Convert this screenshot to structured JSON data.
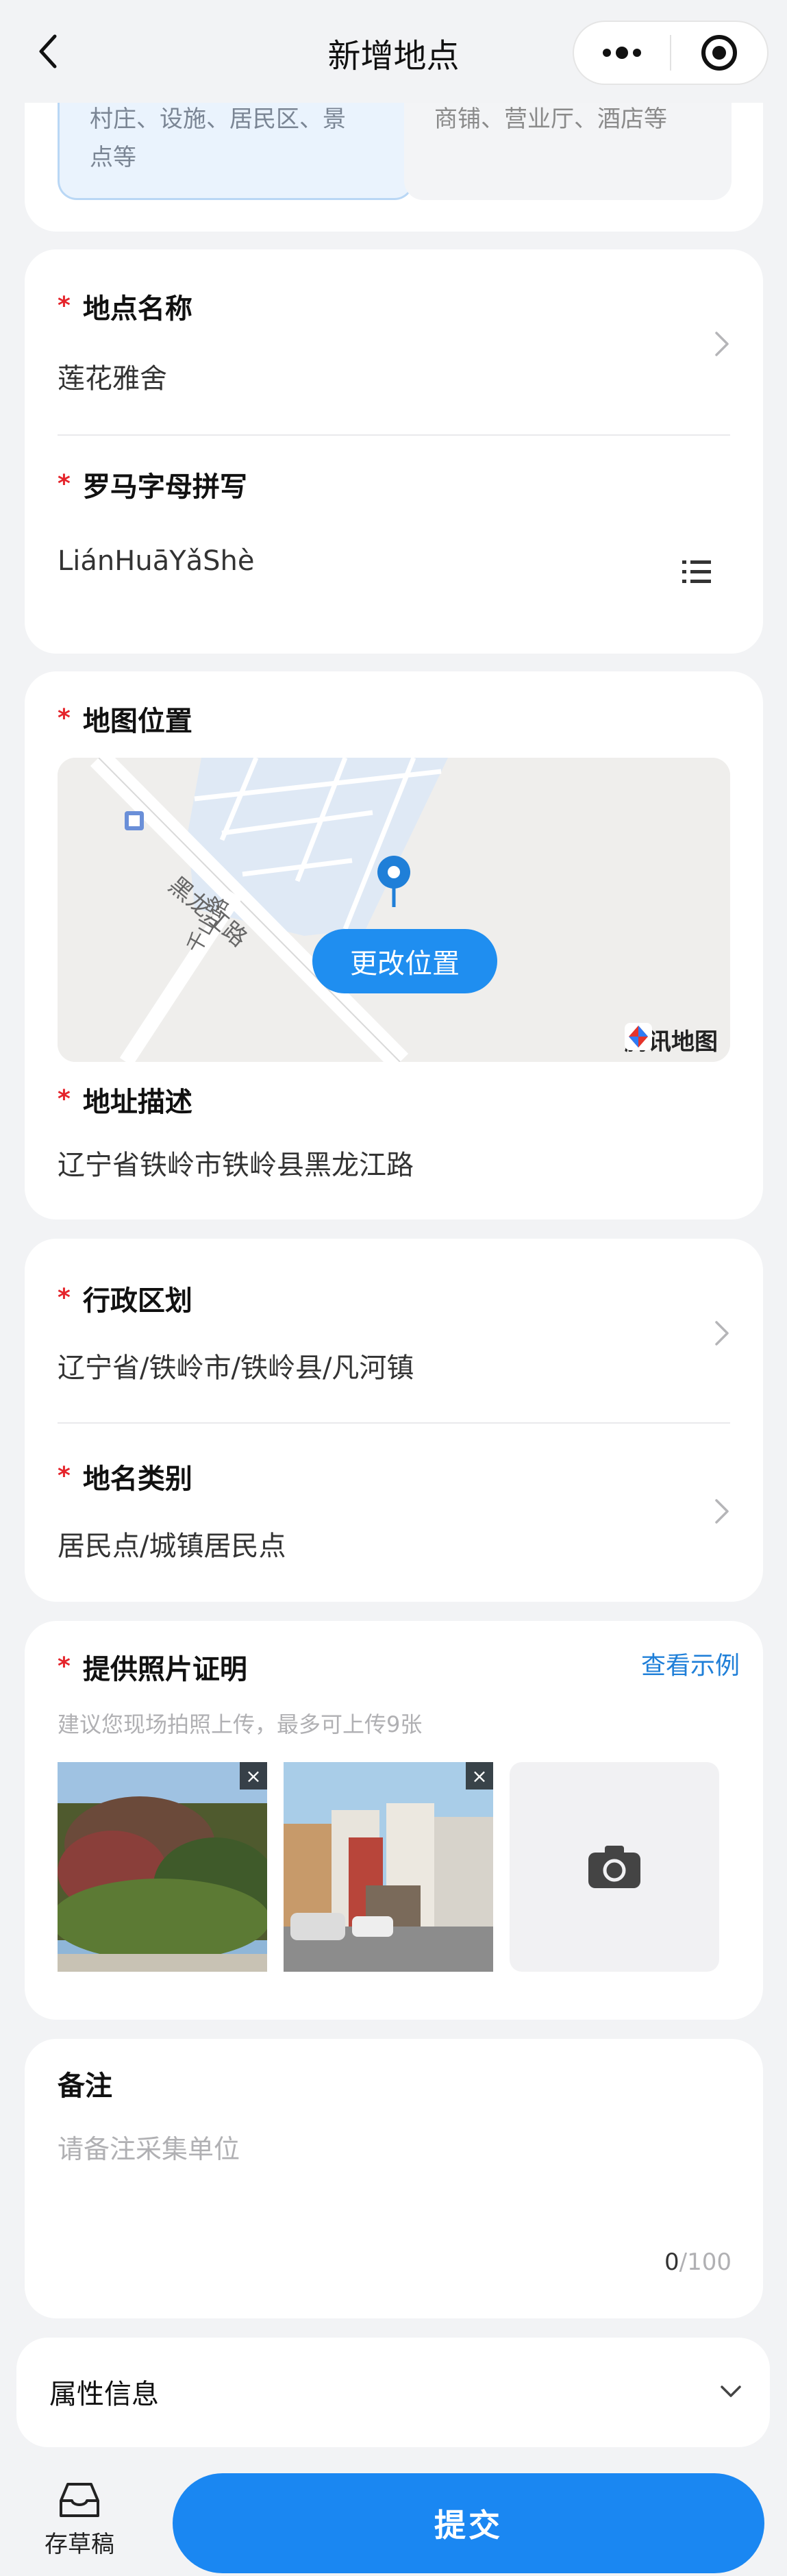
{
  "nav": {
    "title": "新增地点",
    "back_icon": "back-arrow-icon",
    "more_icon": "more-dots-icon",
    "close_icon": "target-close-icon"
  },
  "category": {
    "options": [
      {
        "text_line1": "村庄、设施、居民区、景",
        "text_line2": "点等",
        "selected": true
      },
      {
        "text_line1": "商铺、营业厅、酒店等",
        "selected": false
      }
    ]
  },
  "name_card": {
    "name_label": "地点名称",
    "name_value": "莲花雅舍",
    "roman_label": "罗马字母拼写",
    "roman_value": "LiánHuāYǎShè",
    "list_icon": "list-icon"
  },
  "map_card": {
    "label": "地图位置",
    "change_button": "更改位置",
    "map_logo": "腾讯地图",
    "road1": "黑龙江路",
    "road2": "千山路",
    "address_label": "地址描述",
    "address_value": "辽宁省铁岭市铁岭县黑龙江路"
  },
  "region_card": {
    "region_label": "行政区划",
    "region_value": "辽宁省/铁岭市/铁岭县/凡河镇",
    "type_label": "地名类别",
    "type_value": "居民点/城镇居民点"
  },
  "photo_card": {
    "label": "提供照片证明",
    "example_link": "查看示例",
    "hint": "建议您现场拍照上传，最多可上传9张",
    "remove_symbol": "×",
    "camera_icon": "camera-icon"
  },
  "remark_card": {
    "label": "备注",
    "placeholder": "请备注采集单位",
    "count": "0",
    "max": "/100"
  },
  "attr_card": {
    "label": "属性信息"
  },
  "bottom": {
    "draft_label": "存草稿",
    "submit_label": "提交"
  },
  "colors": {
    "accent": "#1a87f2",
    "required": "#e5242b",
    "link": "#1f7fd8"
  },
  "required_mark": "*"
}
